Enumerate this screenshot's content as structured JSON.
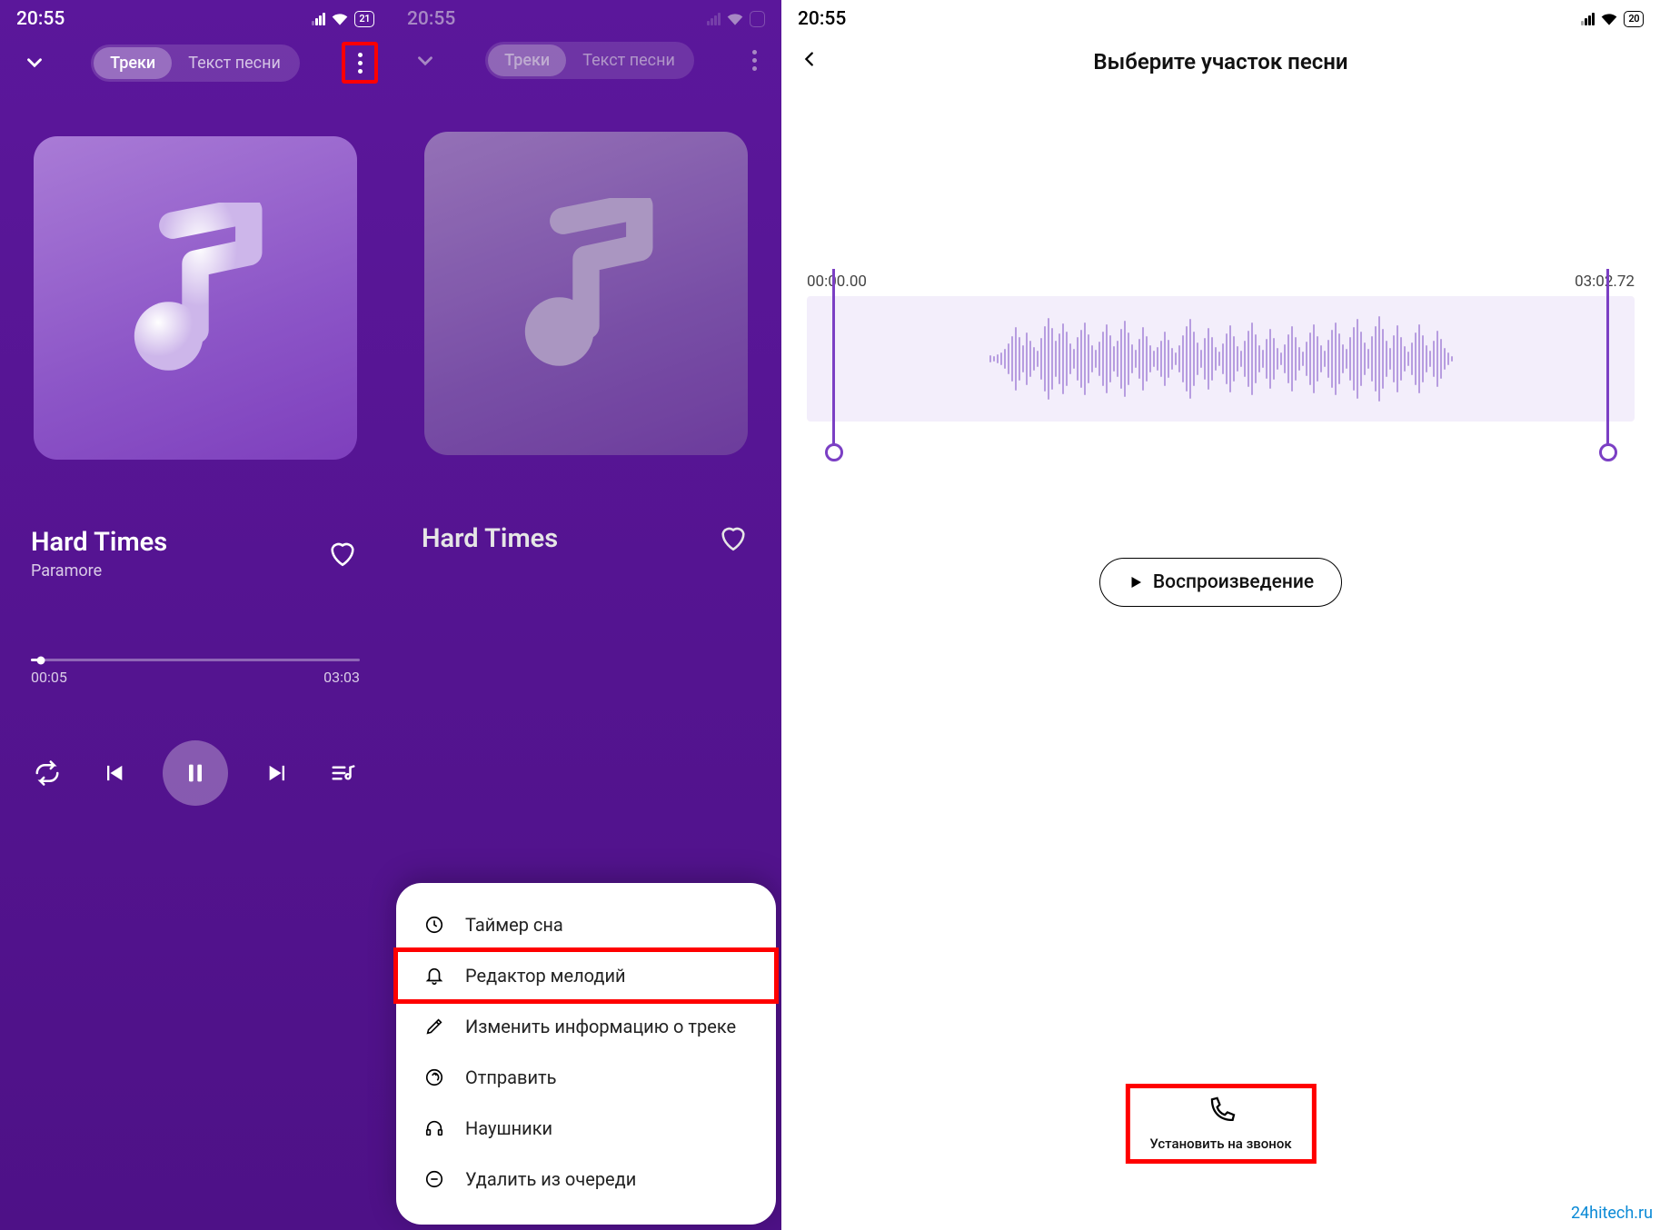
{
  "screen1": {
    "status_time": "20:55",
    "battery": "21",
    "tab_tracks": "Треки",
    "tab_lyrics": "Текст песни",
    "track_title": "Hard Times",
    "track_artist": "Paramore",
    "time_elapsed": "00:05",
    "time_total": "03:03"
  },
  "screen2": {
    "status_time": "20:55",
    "tab_tracks": "Треки",
    "tab_lyrics": "Текст песни",
    "track_title": "Hard Times",
    "menu": [
      {
        "icon": "clock",
        "label": "Таймер сна"
      },
      {
        "icon": "bell",
        "label": "Редактор мелодий",
        "highlight": true
      },
      {
        "icon": "pencil",
        "label": "Изменить информацию о треке"
      },
      {
        "icon": "share",
        "label": "Отправить"
      },
      {
        "icon": "headphones",
        "label": "Наушники"
      },
      {
        "icon": "minus",
        "label": "Удалить из очереди"
      }
    ]
  },
  "screen3": {
    "status_time": "20:55",
    "battery": "20",
    "header_title": "Выберите участок песни",
    "time_start": "00:00.00",
    "time_end": "03:02.72",
    "play_label": "Воспроизведение",
    "set_call_label": "Установить на звонок"
  },
  "watermark": "24hitech.ru"
}
